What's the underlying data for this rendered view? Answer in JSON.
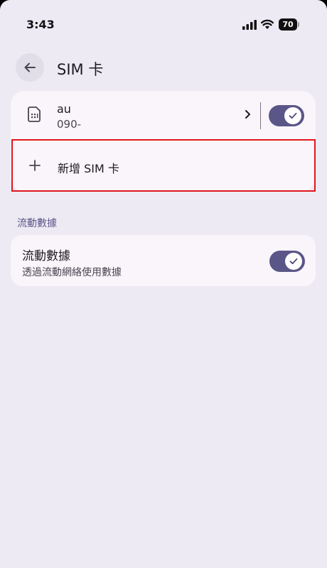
{
  "status_bar": {
    "time": "3:43",
    "battery": "70"
  },
  "header": {
    "title": "SIM 卡"
  },
  "sim": {
    "carrier": "au",
    "number": "090-",
    "enabled": true
  },
  "add_sim": {
    "label": "新增 SIM 卡"
  },
  "mobile_data": {
    "section_title": "流動數據",
    "title": "流動數據",
    "subtitle": "透過流動網絡使用數據",
    "enabled": true
  },
  "colors": {
    "background": "#eeeaf4",
    "card": "#f9f5fb",
    "accent": "#5b5688",
    "highlight": "#e0161c"
  },
  "icons": [
    "signal-icon",
    "wifi-icon",
    "battery-icon",
    "back-arrow-icon",
    "sim-card-icon",
    "chevron-right-icon",
    "plus-icon",
    "checkmark-icon"
  ]
}
